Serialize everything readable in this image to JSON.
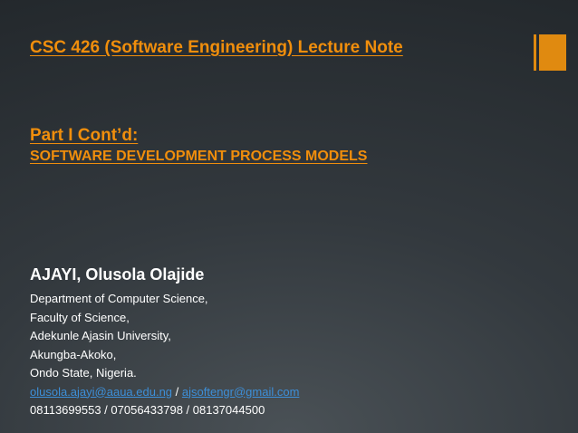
{
  "slide": {
    "title": "CSC 426 (Software Engineering) Lecture Note",
    "part_title": "Part I Cont’d:",
    "part_subtitle": "SOFTWARE DEVELOPMENT PROCESS MODELS",
    "author": "AJAYI, Olusola Olajide",
    "affiliation": [
      "Department of Computer Science,",
      "Faculty of Science,",
      "Adekunle Ajasin University,",
      "Akungba-Akoko,",
      "Ondo State, Nigeria."
    ],
    "email_primary": "olusola.ajayi@aaua.edu.ng",
    "email_separator": " / ",
    "email_secondary": "ajsoftengr@gmail.com",
    "phones": "08113699553 / 07056433798 / 08137044500"
  },
  "colors": {
    "accent": "#f08e0c",
    "link": "#3d8fd8",
    "background": "#2b3035",
    "text": "#ffffff"
  }
}
